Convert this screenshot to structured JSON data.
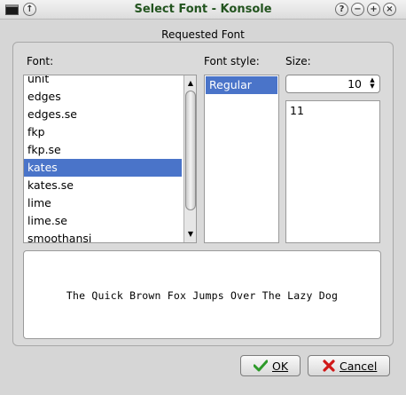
{
  "window": {
    "title": "Select Font - Konsole",
    "buttons": {
      "help": "?",
      "minimize": "−",
      "maximize": "+",
      "close": "×",
      "menu": "↑"
    }
  },
  "group": {
    "title": "Requested Font"
  },
  "labels": {
    "font": "Font:",
    "style": "Font style:",
    "size": "Size:"
  },
  "font_list": {
    "items": [
      "unit",
      "edges",
      "edges.se",
      "fkp",
      "fkp.se",
      "kates",
      "kates.se",
      "lime",
      "lime.se",
      "smoothansi"
    ],
    "selected": "kates"
  },
  "style_list": {
    "items": [
      "Regular"
    ],
    "selected": "Regular"
  },
  "size": {
    "value": "10",
    "list_items": [
      "11"
    ]
  },
  "preview": {
    "text": "The Quick Brown Fox Jumps Over The Lazy Dog"
  },
  "buttons": {
    "ok_label": "OK",
    "cancel_label": "Cancel"
  },
  "colors": {
    "selection": "#4a74c9",
    "title_text": "#23541f",
    "ok_check": "#2e9a2a",
    "cancel_x": "#d01818"
  }
}
